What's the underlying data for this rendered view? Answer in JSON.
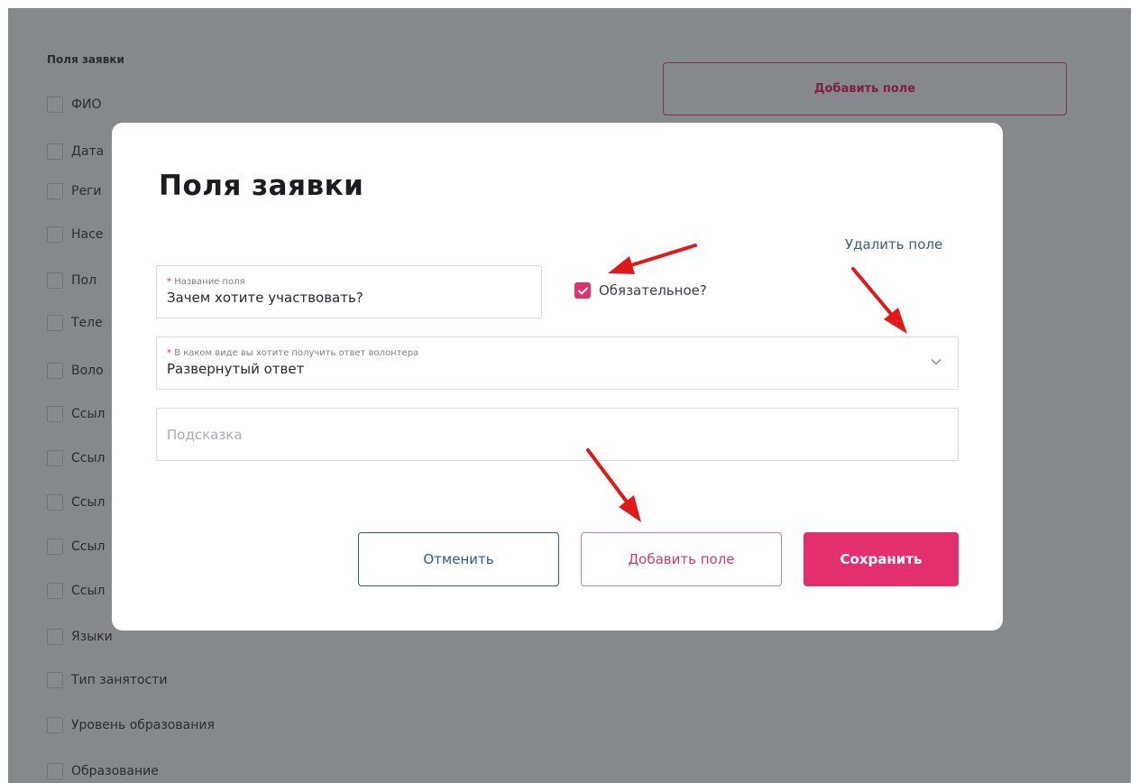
{
  "background": {
    "section_title": "Поля заявки",
    "add_field_label": "Добавить поле",
    "items": [
      {
        "label": "ФИО"
      },
      {
        "label": "Дата"
      },
      {
        "label": "Реги"
      },
      {
        "label": "Насе"
      },
      {
        "label": "Пол"
      },
      {
        "label": "Теле"
      },
      {
        "label": "Воло"
      },
      {
        "label": "Ссыл"
      },
      {
        "label": "Ссыл"
      },
      {
        "label": "Ссыл"
      },
      {
        "label": "Ссыл"
      },
      {
        "label": "Ссыл"
      },
      {
        "label": "Языки"
      },
      {
        "label": "Тип занятости"
      },
      {
        "label": "Уровень образования"
      },
      {
        "label": "Образование"
      }
    ]
  },
  "modal": {
    "title": "Поля заявки",
    "delete_link": "Удалить поле",
    "field_name": {
      "required_mark": "*",
      "label": "Название поля",
      "value": "Зачем хотите участвовать?"
    },
    "required_checkbox": {
      "label": "Обязательное?",
      "checked": true
    },
    "answer_type": {
      "required_mark": "*",
      "label": "В каком виде вы хотите получить ответ волонтера",
      "value": "Развернутый ответ",
      "icon": "chevron-down-icon"
    },
    "hint": {
      "placeholder": "Подсказка"
    },
    "buttons": {
      "cancel": "Отменить",
      "add_field": "Добавить поле",
      "save": "Сохранить"
    }
  },
  "colors": {
    "accent": "#e42f6f",
    "link": "#3f5a86",
    "cancel_border": "#2e5a7f",
    "overlay_bg": "#85898b",
    "annotation_arrow": "#e01a1a"
  }
}
